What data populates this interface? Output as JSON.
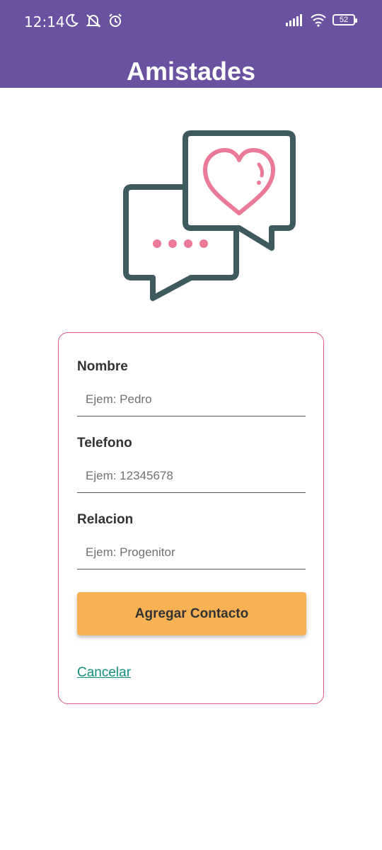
{
  "status_bar": {
    "time": "12:14",
    "left_icons": [
      "moon-icon",
      "mute-icon",
      "alarm-icon"
    ],
    "right_icons": [
      "signal-icon",
      "wifi-icon",
      "battery-icon"
    ],
    "battery": "52"
  },
  "header": {
    "title": "Amistades",
    "background": "#6b52a0"
  },
  "illustration": {
    "icon": "chat-bubbles-heart-icon",
    "stroke_color": "#3e5a5e",
    "accent_color": "#ea7a98"
  },
  "form": {
    "border_color": "#d9587f",
    "fields": [
      {
        "label": "Nombre",
        "placeholder": "Ejem: Pedro",
        "value": ""
      },
      {
        "label": "Telefono",
        "placeholder": "Ejem: 12345678",
        "value": ""
      },
      {
        "label": "Relacion",
        "placeholder": "Ejem: Progenitor",
        "value": ""
      }
    ],
    "submit_label": "Agregar Contacto",
    "submit_color": "#f8b254",
    "cancel_label": "Cancelar",
    "cancel_color": "#128f7c"
  }
}
